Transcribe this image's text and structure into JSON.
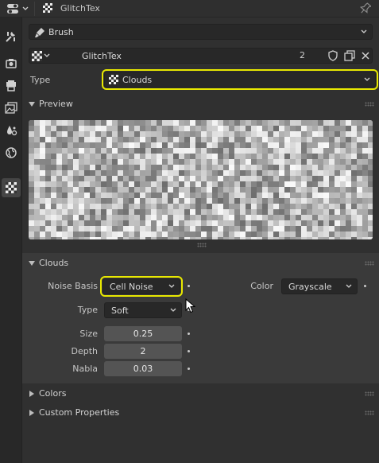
{
  "header": {
    "editor_icon": "properties-editor-icon",
    "texture_name": "GlitchTex"
  },
  "tabs": [
    {
      "icon": "tool-icon",
      "active": false
    },
    {
      "icon": "render-icon",
      "active": false
    },
    {
      "icon": "output-icon",
      "active": false
    },
    {
      "icon": "view-layer-icon",
      "active": false
    },
    {
      "icon": "scene-icon",
      "active": false
    },
    {
      "icon": "world-icon",
      "active": false
    },
    {
      "icon": "texture-icon",
      "active": true
    }
  ],
  "context": {
    "brush_label": "Brush",
    "texture_name": "GlitchTex",
    "users": "2"
  },
  "type_row": {
    "label": "Type",
    "value": "Clouds"
  },
  "preview": {
    "title": "Preview"
  },
  "clouds": {
    "title": "Clouds",
    "noise_basis_label": "Noise Basis",
    "noise_basis_value": "Cell Noise",
    "color_label": "Color",
    "color_value": "Grayscale",
    "type_label": "Type",
    "type_value": "Soft",
    "size_label": "Size",
    "size_value": "0.25",
    "depth_label": "Depth",
    "depth_value": "2",
    "nabla_label": "Nabla",
    "nabla_value": "0.03"
  },
  "colors_panel": {
    "title": "Colors"
  },
  "custom_props_panel": {
    "title": "Custom Properties"
  },
  "colors": {
    "highlight": "#e8e800",
    "background": "#303030",
    "field": "#545454",
    "dropdown": "#282828"
  }
}
